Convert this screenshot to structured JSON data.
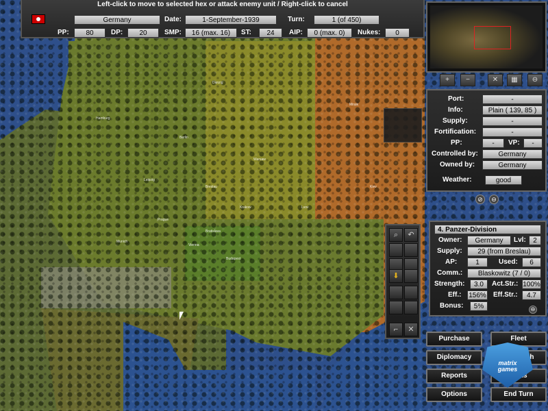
{
  "hint": "Left-click to move to selected hex or attack enemy unit / Right-click to cancel",
  "top": {
    "nation": "Germany",
    "date_label": "Date:",
    "date": "1-September-1939",
    "turn_label": "Turn:",
    "turn": "1 (of 450)",
    "pp_label": "PP:",
    "pp": "80",
    "dp_label": "DP:",
    "dp": "20",
    "smp_label": "SMP:",
    "smp": "16 (max. 16)",
    "st_label": "ST:",
    "st": "24",
    "aip_label": "AIP:",
    "aip": "0 (max. 0)",
    "nukes_label": "Nukes:",
    "nukes": "0"
  },
  "hex": {
    "port_label": "Port:",
    "port": "-",
    "info_label": "Info:",
    "info": "Plain ( 139, 85 )",
    "supply_label": "Supply:",
    "supply": "-",
    "fort_label": "Fortification:",
    "fort": "-",
    "pp_label": "PP:",
    "pp": "-",
    "vp_label": "VP:",
    "vp": "-",
    "controlled_label": "Controlled by:",
    "controlled": "Germany",
    "owned_label": "Owned by:",
    "owned": "Germany",
    "weather_label": "Weather:",
    "weather": "good"
  },
  "unit": {
    "name": "4. Panzer-Division",
    "owner_label": "Owner:",
    "owner": "Germany",
    "lvl_label": "Lvl:",
    "lvl": "2",
    "supply_label": "Supply:",
    "supply": "29 (from Breslau)",
    "ap_label": "AP:",
    "ap": "1",
    "used_label": "Used:",
    "used": "6",
    "comm_label": "Comm.:",
    "comm": "Blaskowitz (7 / 0)",
    "strength_label": "Strength:",
    "strength": "3.0",
    "actstr_label": "Act.Str.:",
    "actstr": "100%",
    "eff_label": "Eff.:",
    "eff": "156%",
    "effstr_label": "Eff.Str.:",
    "effstr": "4.7",
    "bonus_label": "Bonus:",
    "bonus": "5%"
  },
  "buttons": {
    "purchase": "Purchase",
    "fleet": "Fleet",
    "diplomacy": "Diplomacy",
    "research": "Research",
    "reports": "Reports",
    "units": "Units",
    "options": "Options",
    "end_turn": "End Turn"
  },
  "logo": {
    "line1": "matrix",
    "line2": "games"
  },
  "cities": [
    "Berlin",
    "Warsaw",
    "Breslau",
    "Prague",
    "Vienna",
    "Budapest",
    "Danzig",
    "Hamburg",
    "Munich",
    "Lvov",
    "Minsk",
    "Kiev",
    "Bratislava",
    "Krakow",
    "Leipzig"
  ]
}
